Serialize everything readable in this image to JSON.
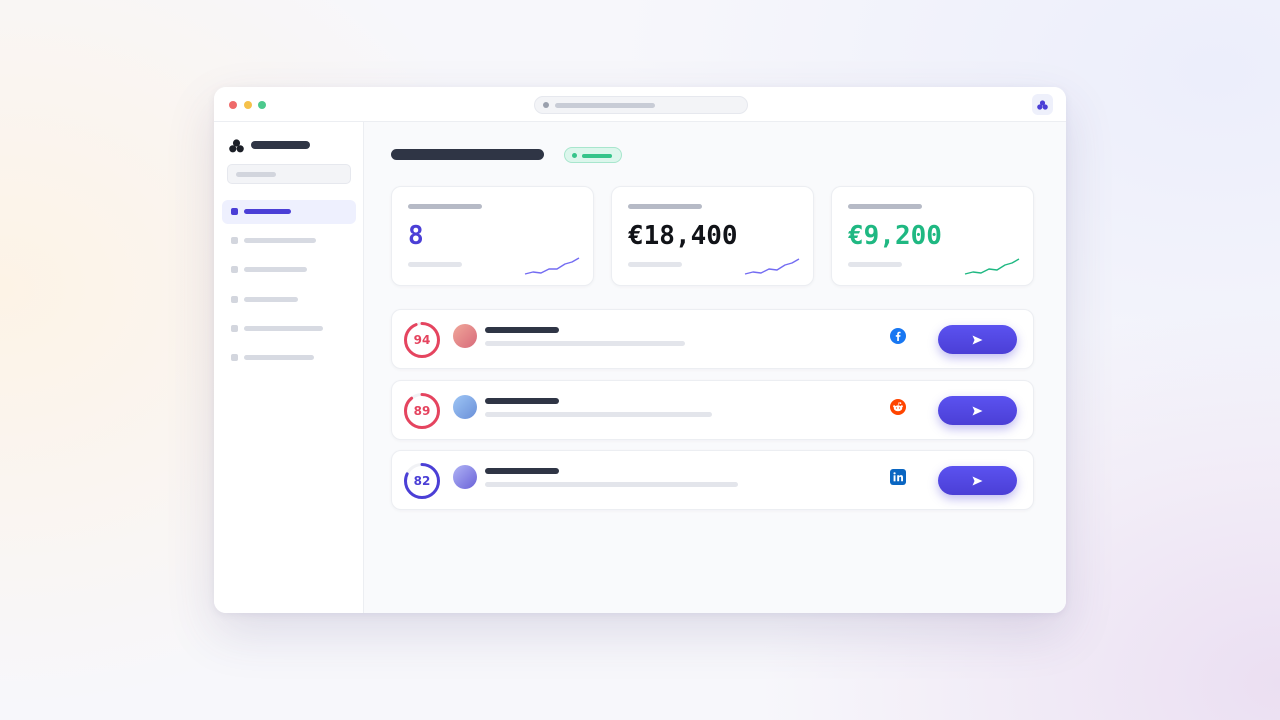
{
  "colors": {
    "accent": "#4b3fd6",
    "success": "#1fb882",
    "danger": "#e5445f",
    "text_dark": "#111318"
  },
  "icons": {
    "brand": "trefoil-logo-icon",
    "send": "send-icon",
    "facebook": "facebook-icon",
    "reddit": "reddit-icon",
    "linkedin": "linkedin-icon"
  },
  "stats": [
    {
      "value": "8",
      "color": "#4b3fd6"
    },
    {
      "value": "€18,400",
      "color": "#111318"
    },
    {
      "value": "€9,200",
      "color": "#1fb882"
    }
  ],
  "leads": [
    {
      "score": "94",
      "score_fraction": 0.94,
      "ring_color": "#e5445f",
      "avatar_colors": [
        "#f0a79a",
        "#d86a7a"
      ],
      "channel": "facebook"
    },
    {
      "score": "89",
      "score_fraction": 0.89,
      "ring_color": "#e5445f",
      "avatar_colors": [
        "#9ec6f5",
        "#6a8fd8"
      ],
      "channel": "reddit"
    },
    {
      "score": "82",
      "score_fraction": 0.82,
      "ring_color": "#4b3fd6",
      "avatar_colors": [
        "#b0b4f5",
        "#6a62d8"
      ],
      "channel": "linkedin"
    }
  ]
}
